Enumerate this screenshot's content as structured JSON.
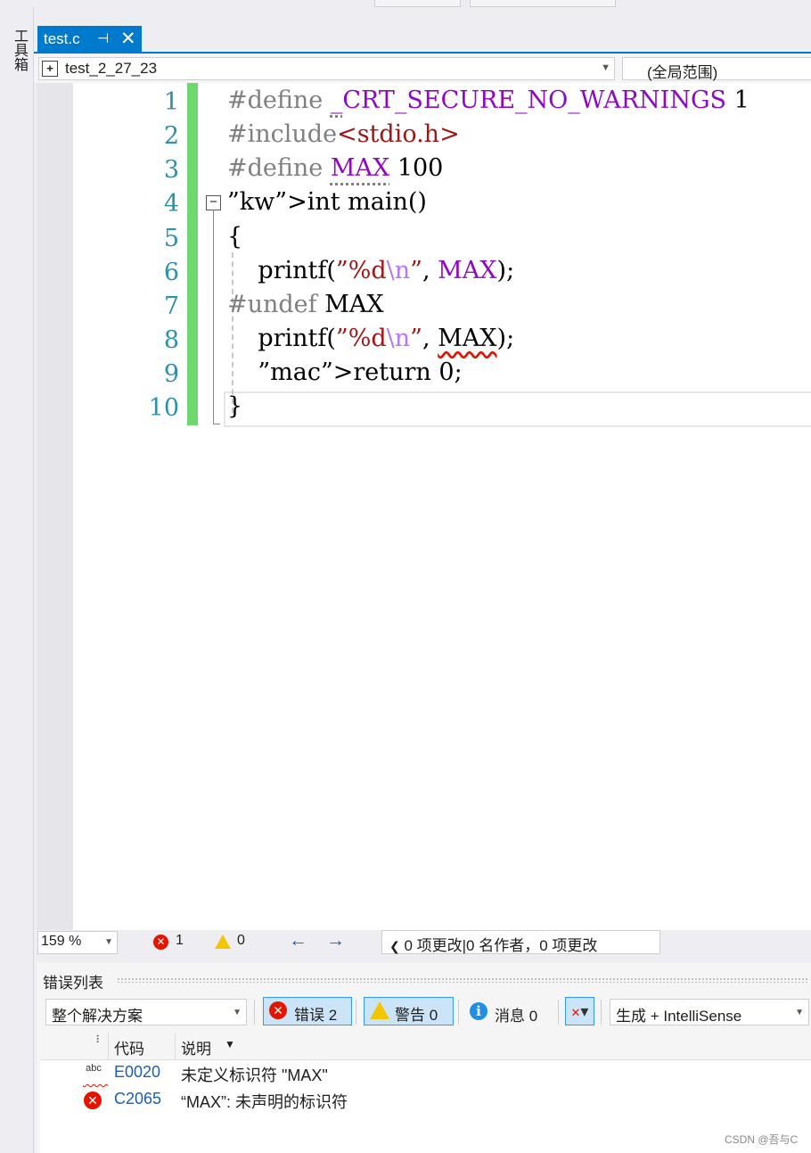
{
  "toolbox": {
    "label": "工具箱"
  },
  "tab": {
    "file_name": "test.c",
    "pin_glyph": "⊣",
    "close_glyph": "✕"
  },
  "navbar": {
    "project": "test_2_27_23",
    "scope": "(全局范围)"
  },
  "editor": {
    "line_numbers": [
      "1",
      "2",
      "3",
      "4",
      "5",
      "6",
      "7",
      "8",
      "9",
      "10"
    ],
    "lines": [
      "#define _CRT_SECURE_NO_WARNINGS 1",
      "#include<stdio.h>",
      "#define MAX 100",
      "int main()",
      "{",
      "printf(\"%d\\n\", MAX);",
      "#undef MAX",
      "printf(\"%d\\n\", MAX);",
      "return 0;",
      "}"
    ]
  },
  "statusbar": {
    "zoom": "159 %",
    "error_count": "1",
    "warning_count": "0",
    "changes": "0 项更改|0 名作者，0 项更改"
  },
  "error_list": {
    "title": "错误列表",
    "scope": "整个解决方案",
    "errors_button": "错误 2",
    "warnings_button": "警告 0",
    "messages_button": "消息 0",
    "source": "生成 + IntelliSense",
    "columns": {
      "code": "代码",
      "description": "说明"
    },
    "rows": [
      {
        "icon": "intellisense-error-icon",
        "code": "E0020",
        "description": "未定义标识符 \"MAX\""
      },
      {
        "icon": "build-error-icon",
        "code": "C2065",
        "description": "“MAX”: 未声明的标识符"
      }
    ]
  },
  "watermark": "CSDN @吾与C",
  "colors": {
    "accent": "#007acc",
    "line_number": "#2b91af",
    "keyword": "#0000ff",
    "macro": "#8f08c4",
    "string": "#a31515",
    "change_bar": "#6ed86e",
    "error": "#e51400"
  }
}
